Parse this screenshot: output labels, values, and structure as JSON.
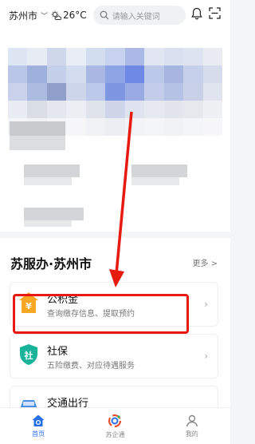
{
  "topbar": {
    "city": "苏州市",
    "temperature": "26°C",
    "search_placeholder": "请输入关键词"
  },
  "section": {
    "title": "苏服办·苏州市",
    "more_label": "更多 >",
    "cards": [
      {
        "title": "公积金",
        "subtitle": "查询缴存信息、提取预约",
        "icon": "house-yuan-icon",
        "color": "#f5a623"
      },
      {
        "title": "社保",
        "subtitle": "五险缴费、对应待遇服务",
        "icon": "shield-she-icon",
        "color": "#19b39a"
      },
      {
        "title": "交通出行",
        "subtitle": "",
        "icon": "car-icon",
        "color": "#4a90e2"
      }
    ]
  },
  "nav": {
    "tabs": [
      {
        "label": "首页",
        "active": true
      },
      {
        "label": "苏企通",
        "active": false
      },
      {
        "label": "我的",
        "active": false
      }
    ]
  },
  "colors": {
    "accent": "#2b6fe6",
    "highlight": "#e8190f"
  }
}
